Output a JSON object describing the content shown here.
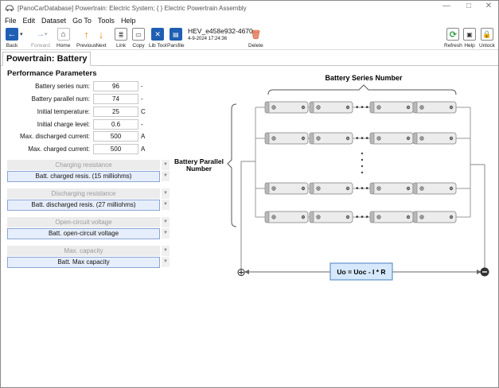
{
  "window": {
    "title": "[PanoCarDatabase] Powertrain: Electric System; { } Electric Powertrain Assembly",
    "minimize": "—",
    "maximize": "□",
    "close": "✕"
  },
  "menu": [
    "File",
    "Edit",
    "Dataset",
    "Go To",
    "Tools",
    "Help"
  ],
  "toolbar": {
    "back": "Back",
    "forward": "Forward",
    "home": "Home",
    "previous": "Previous",
    "next": "Next",
    "link": "Link",
    "copy": "Copy",
    "libtool": "Lib Tool",
    "parsfile": "Parsfile",
    "record_name": "HEV_e458e932-4670",
    "record_time": "4-9-2024 17:24:36",
    "delete": "Delete",
    "refresh": "Refresh",
    "help": "Help",
    "unlock": "Unlock"
  },
  "tab": {
    "label": "Powertrain: Battery"
  },
  "section": {
    "title": "Performance Parameters"
  },
  "params": [
    {
      "label": "Battery series num:",
      "value": "96",
      "unit": "-"
    },
    {
      "label": "Battery parallel num:",
      "value": "74",
      "unit": "-"
    },
    {
      "label": "Initial temperature:",
      "value": "25",
      "unit": "C"
    },
    {
      "label": "Initial charge level:",
      "value": "0.6",
      "unit": "-"
    },
    {
      "label": "Max. discharged current:",
      "value": "500",
      "unit": "A"
    },
    {
      "label": "Max. charged current:",
      "value": "500",
      "unit": "A"
    }
  ],
  "groups": [
    {
      "header": "Charging resistance",
      "value": "Batt. charged resis. (15 milliohms)"
    },
    {
      "header": "Discharging resistance",
      "value": "Batt. discharged resis. (27 milliohms)"
    },
    {
      "header": "Open-circuit voltage",
      "value": "Batt. open-circuit voltage"
    },
    {
      "header": "Max. capacity",
      "value": "Batt. Max capacity"
    }
  ],
  "diagram": {
    "series_label": "Battery Series Number",
    "parallel_label_line1": "Battery Parallel",
    "parallel_label_line2": "Number",
    "formula": "Uo = Uoc - I * R",
    "plus_terminal": "⊕",
    "minus_terminal": "⊖"
  },
  "colors": {
    "accent_blue": "#1f5fb4",
    "arrow_orange": "#f08a1c",
    "refresh_green": "#2e9b3e",
    "formula_fill": "#d6e8fb",
    "selected_field": "#e7eefb"
  }
}
